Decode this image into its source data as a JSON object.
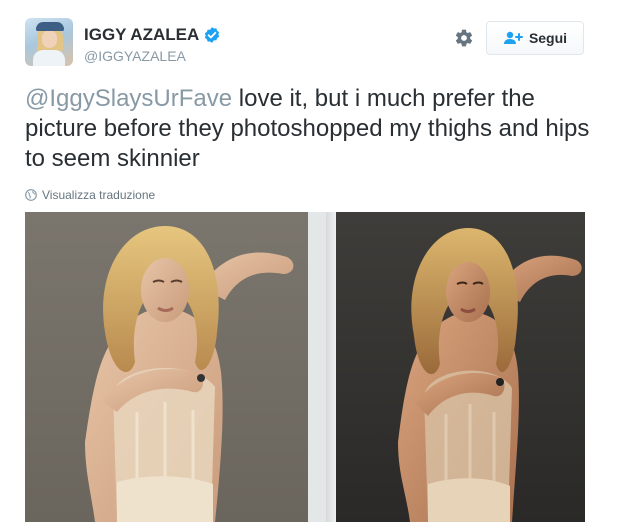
{
  "profile": {
    "display_name": "IGGY AZALEA",
    "handle": "@IGGYAZALEA",
    "verified": true
  },
  "actions": {
    "follow_label": "Segui"
  },
  "tweet": {
    "mention": "@IggySlaysUrFave",
    "text": " love it, but i much prefer the picture before they photoshopped my thighs and hips to seem skinnier"
  },
  "translate": {
    "label": "Visualizza traduzione"
  },
  "colors": {
    "verified_blue": "#1da1f2",
    "mention_gray": "#8899a6",
    "text_dark": "#292f33",
    "meta_gray": "#66757f"
  },
  "icons": {
    "verified": "verified-badge-icon",
    "settings": "gear-icon",
    "follow": "add-user-icon",
    "translate": "globe-icon"
  }
}
